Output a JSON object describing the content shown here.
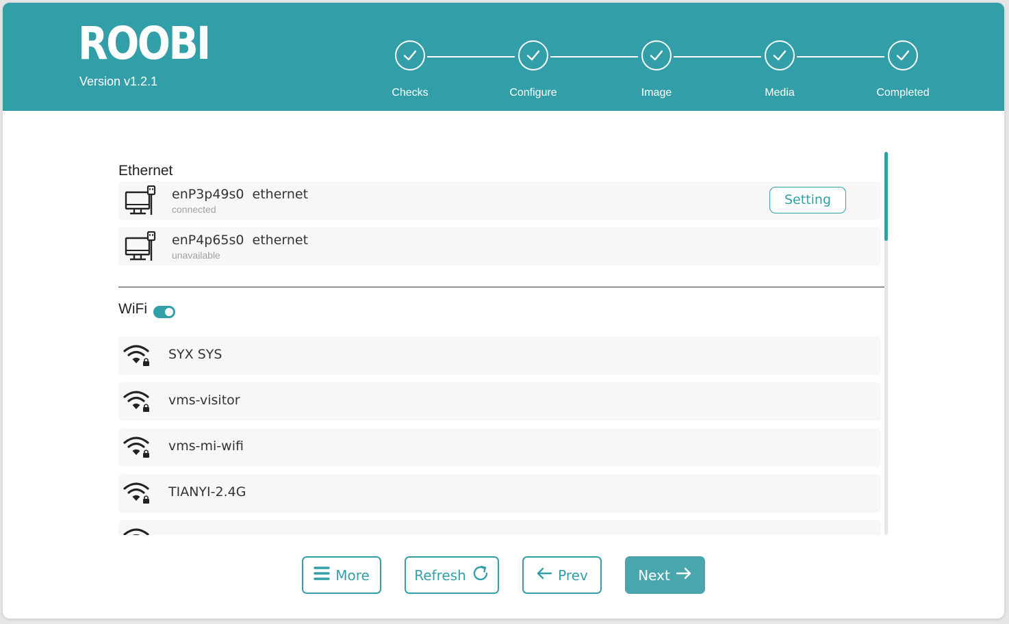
{
  "app": {
    "logo": "ROOBI",
    "version": "Version v1.2.1",
    "brand_color": "#329fa8"
  },
  "steps": [
    {
      "label": "Checks",
      "icon": "check-circle-icon"
    },
    {
      "label": "Configure",
      "icon": "check-circle-icon"
    },
    {
      "label": "Image",
      "icon": "check-circle-icon"
    },
    {
      "label": "Media",
      "icon": "check-circle-icon"
    },
    {
      "label": "Completed",
      "icon": "check-circle-icon"
    }
  ],
  "ethernet": {
    "title": "Ethernet",
    "items": [
      {
        "device": "enP3p49s0",
        "type": "ethernet",
        "status": "connected",
        "action": "Setting"
      },
      {
        "device": "enP4p65s0",
        "type": "ethernet",
        "status": "unavailable"
      }
    ]
  },
  "wifi": {
    "title": "WiFi",
    "enabled": true,
    "networks": [
      {
        "ssid": "SYX SYS",
        "icon": "wifi-lock-icon"
      },
      {
        "ssid": "vms-visitor",
        "icon": "wifi-lock-icon"
      },
      {
        "ssid": "vms-mi-wifi",
        "icon": "wifi-lock-icon"
      },
      {
        "ssid": "TIANYI-2.4G",
        "icon": "wifi-lock-icon"
      }
    ]
  },
  "buttons": {
    "more": "More",
    "refresh": "Refresh",
    "prev": "Prev",
    "next": "Next"
  }
}
